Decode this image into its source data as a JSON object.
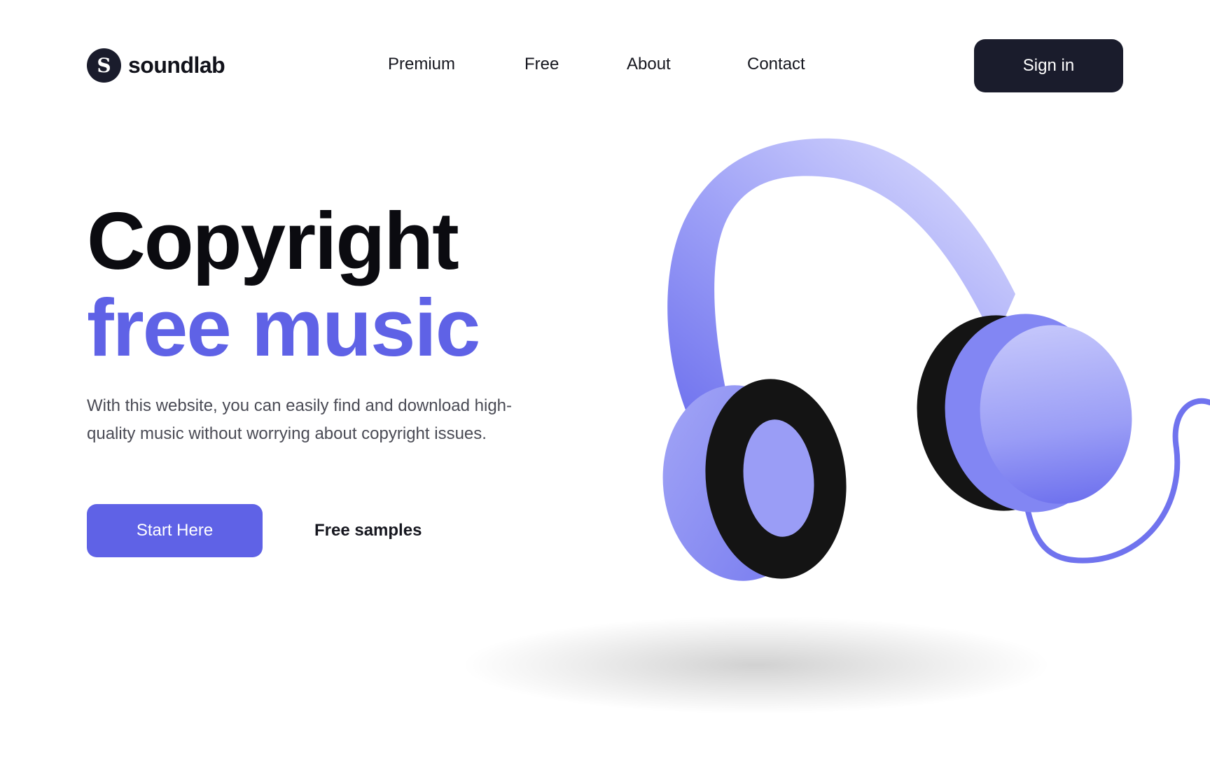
{
  "brand": {
    "logo_letter": "S",
    "name": "soundlab"
  },
  "nav": {
    "items": [
      {
        "label": "Premium"
      },
      {
        "label": "Free"
      },
      {
        "label": "About"
      },
      {
        "label": "Contact"
      }
    ],
    "signin_label": "Sign in"
  },
  "hero": {
    "title_line1": "Copyright",
    "title_line2": "free music",
    "description": "With this website, you can easily find and download high-quality music without worrying about copyright issues.",
    "primary_cta": "Start Here",
    "secondary_cta": "Free samples"
  },
  "illustration": {
    "icon": "headphones-icon"
  },
  "colors": {
    "accent": "#5f62e6",
    "dark": "#1a1c2c",
    "text_muted": "#4a4b55",
    "headphone_light": "#a7aaf7",
    "headphone_band_light": "#d9dbfd",
    "earpad": "#141414"
  }
}
